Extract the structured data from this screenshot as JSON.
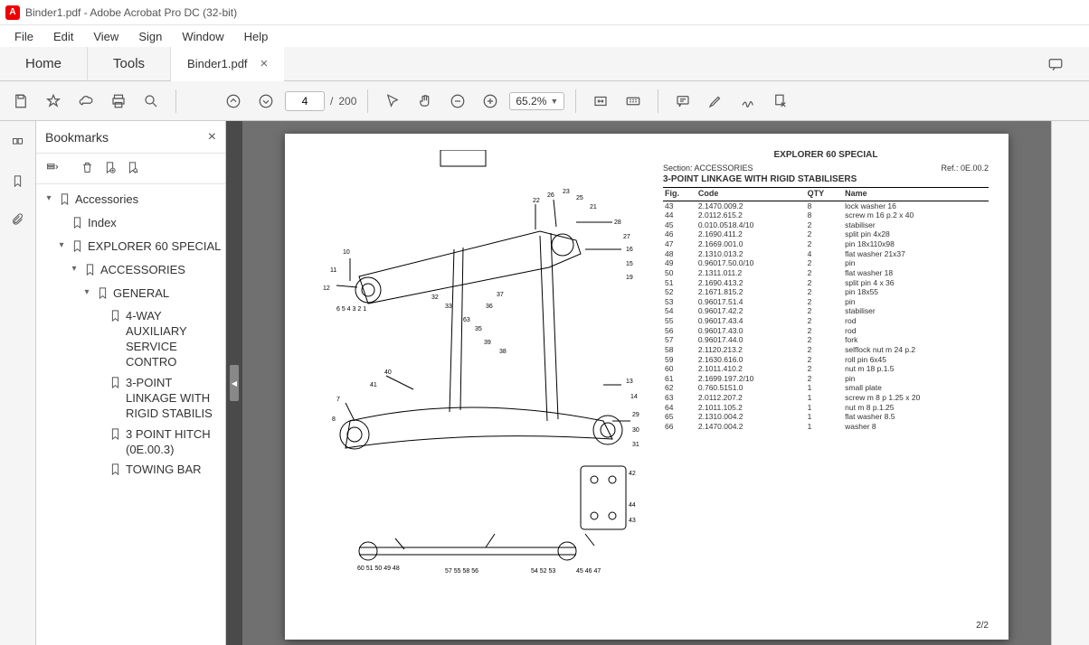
{
  "window": {
    "title": "Binder1.pdf - Adobe Acrobat Pro DC (32-bit)",
    "app_icon_letter": "A"
  },
  "menu": [
    "File",
    "Edit",
    "View",
    "Sign",
    "Window",
    "Help"
  ],
  "tabs": {
    "home": "Home",
    "tools": "Tools",
    "doc": "Binder1.pdf"
  },
  "toolbar": {
    "page_current": "4",
    "page_total": "200",
    "zoom": "65.2%"
  },
  "bookmarks": {
    "title": "Bookmarks",
    "tree": [
      {
        "label": "Accessories",
        "expanded": true,
        "indent": 0,
        "children": true
      },
      {
        "label": "Index",
        "expanded": false,
        "indent": 1,
        "children": false
      },
      {
        "label": "EXPLORER 60 SPECIAL",
        "expanded": true,
        "indent": 1,
        "children": true
      },
      {
        "label": "ACCESSORIES",
        "expanded": true,
        "indent": 2,
        "children": true
      },
      {
        "label": "GENERAL",
        "expanded": true,
        "indent": 3,
        "children": true
      },
      {
        "label": "4-WAY AUXILIARY SERVICE CONTRO",
        "expanded": false,
        "indent": 4,
        "children": false
      },
      {
        "label": "3-POINT LINKAGE WITH RIGID STABILIS",
        "expanded": false,
        "indent": 4,
        "children": false
      },
      {
        "label": "3 POINT HITCH (0E.00.3)",
        "expanded": false,
        "indent": 4,
        "children": false
      },
      {
        "label": "TOWING BAR",
        "expanded": false,
        "indent": 4,
        "children": false
      }
    ]
  },
  "document": {
    "model": "EXPLORER 60 SPECIAL",
    "section_label": "Section: ACCESSORIES",
    "ref_label": "Ref.: 0E.00.2",
    "title": "3-POINT LINKAGE WITH RIGID STABILISERS",
    "page_num": "2/2",
    "columns": [
      "Fig.",
      "Code",
      "QTY",
      "Name"
    ],
    "rows": [
      {
        "fig": "43",
        "code": "2.1470.009.2",
        "qty": "8",
        "name": "lock washer 16"
      },
      {
        "fig": "44",
        "code": "2.0112.615.2",
        "qty": "8",
        "name": "screw m 16 p.2 x 40"
      },
      {
        "fig": "45",
        "code": "0.010.0518.4/10",
        "qty": "2",
        "name": "stabiliser"
      },
      {
        "fig": "46",
        "code": "2.1690.411.2",
        "qty": "2",
        "name": "split pin 4x28"
      },
      {
        "fig": "47",
        "code": "2.1669.001.0",
        "qty": "2",
        "name": "pin 18x110x98"
      },
      {
        "fig": "48",
        "code": "2.1310.013.2",
        "qty": "4",
        "name": "flat washer 21x37"
      },
      {
        "fig": "49",
        "code": "0.96017.50.0/10",
        "qty": "2",
        "name": "pin"
      },
      {
        "fig": "50",
        "code": "2.1311.011.2",
        "qty": "2",
        "name": "flat washer 18"
      },
      {
        "fig": "51",
        "code": "2.1690.413.2",
        "qty": "2",
        "name": "split pin 4 x 36"
      },
      {
        "fig": "52",
        "code": "2.1671.815.2",
        "qty": "2",
        "name": "pin 18x55"
      },
      {
        "fig": "53",
        "code": "0.96017.51.4",
        "qty": "2",
        "name": "pin"
      },
      {
        "fig": "54",
        "code": "0.96017.42.2",
        "qty": "2",
        "name": "stabiliser"
      },
      {
        "fig": "55",
        "code": "0.96017.43.4",
        "qty": "2",
        "name": "rod"
      },
      {
        "fig": "56",
        "code": "0.96017.43.0",
        "qty": "2",
        "name": "rod"
      },
      {
        "fig": "57",
        "code": "0.96017.44.0",
        "qty": "2",
        "name": "fork"
      },
      {
        "fig": "58",
        "code": "2.1120.213.2",
        "qty": "2",
        "name": "selflock nut m 24 p.2"
      },
      {
        "fig": "59",
        "code": "2.1630.616.0",
        "qty": "2",
        "name": "roll pin 6x45"
      },
      {
        "fig": "60",
        "code": "2.1011.410.2",
        "qty": "2",
        "name": "nut m 18 p.1.5"
      },
      {
        "fig": "61",
        "code": "2.1699.197.2/10",
        "qty": "2",
        "name": "pin"
      },
      {
        "fig": "62",
        "code": "0.760.5151.0",
        "qty": "1",
        "name": "small plate"
      },
      {
        "fig": "63",
        "code": "2.0112.207.2",
        "qty": "1",
        "name": "screw m 8 p 1.25 x 20"
      },
      {
        "fig": "64",
        "code": "2.1011.105.2",
        "qty": "1",
        "name": "nut m 8 p.1.25"
      },
      {
        "fig": "65",
        "code": "2.1310.004.2",
        "qty": "1",
        "name": "flat washer 8.5"
      },
      {
        "fig": "66",
        "code": "2.1470.004.2",
        "qty": "1",
        "name": "washer 8"
      }
    ]
  }
}
